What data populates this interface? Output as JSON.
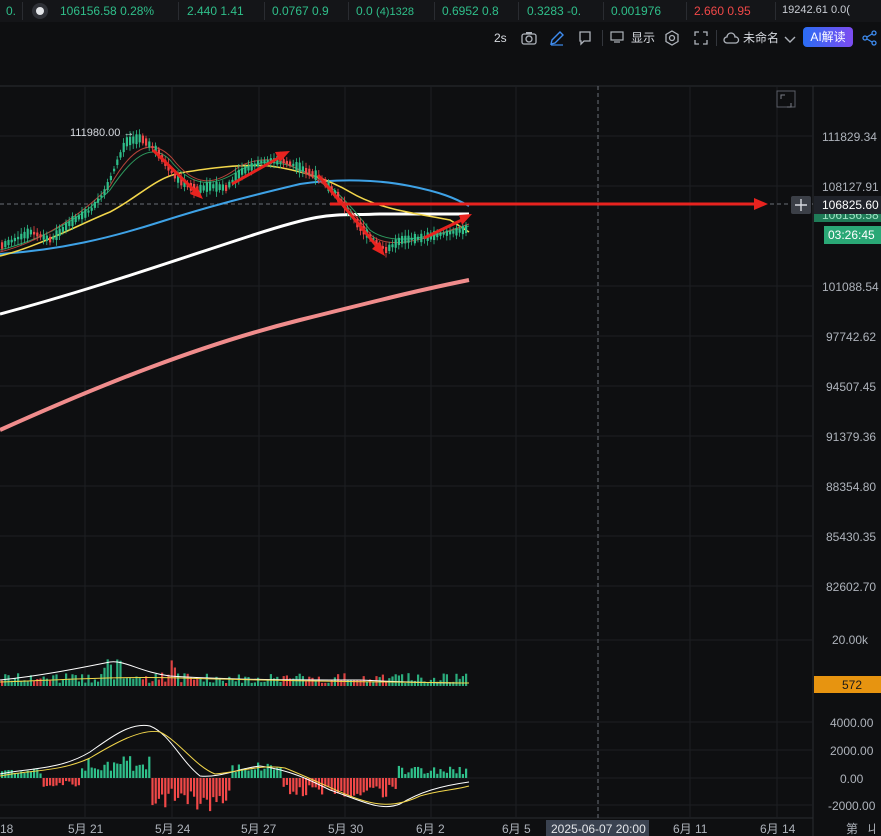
{
  "ticker": [
    {
      "value": "0.",
      "change": "",
      "dir": "up"
    },
    {
      "value": "106156.58",
      "change": "0.28%",
      "dir": "up"
    },
    {
      "value": "2.440",
      "change": "1.41",
      "dir": "up"
    },
    {
      "value": "0.0767",
      "change": "0.9",
      "dir": "up"
    },
    {
      "value": "0.0",
      "change": "(4)1328",
      "dir": "up"
    },
    {
      "value": "0.6952",
      "change": "0.8",
      "dir": "up"
    },
    {
      "value": "0.3283",
      "change": "-0.",
      "dir": "up"
    },
    {
      "value": "0.001976",
      "change": "",
      "dir": "up"
    },
    {
      "value": "2.660",
      "change": "0.95",
      "dir": "down"
    },
    {
      "value": "19242.61",
      "change": "0.0(",
      "dir": "flat"
    }
  ],
  "toolbar": {
    "interval": "2s",
    "display_label": "显示",
    "layout_name": "未命名",
    "ai_label": "AI解读"
  },
  "price_axis": {
    "ticks": [
      "111829.34",
      "108127.91",
      "101088.54",
      "97742.62",
      "94507.45",
      "91379.36",
      "88354.80",
      "85430.35",
      "82602.70"
    ],
    "current_price": "106825.60",
    "hidden_price": "106156.58",
    "countdown": "03:26:45",
    "high_marker": "111980.00 →"
  },
  "volume_axis": {
    "top_tick": "20.00k",
    "current_volume": "572"
  },
  "macd_axis": {
    "ticks": [
      "4000.00",
      "2000.00",
      "0.00",
      "-2000.00"
    ]
  },
  "date_axis": {
    "labels": [
      "18",
      "5月 21",
      "5月 24",
      "5月 27",
      "5月 30",
      "6月 2",
      "6月 5",
      "6月 11",
      "6月 14",
      "第",
      "ㄐ"
    ],
    "crosshair_time": "2025-06-07 20:00"
  },
  "colors": {
    "up": "#2fbf8a",
    "down": "#f04848",
    "ma_white": "#ffffff",
    "ma_pink": "#f08c8c",
    "ma_blue": "#3ea2e6",
    "ma_yellow": "#f2d64b",
    "arrow": "#e8231f",
    "accent": "#2a6df4"
  }
}
